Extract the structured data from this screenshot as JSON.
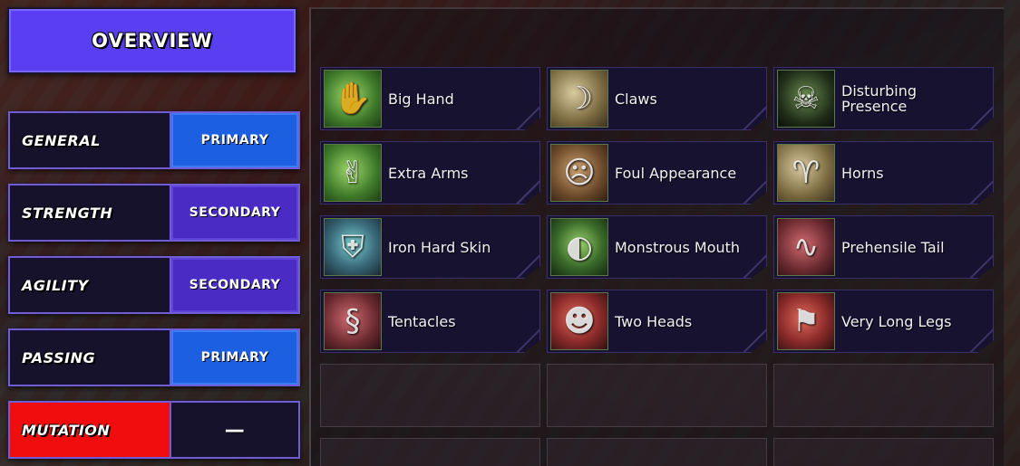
{
  "overview": {
    "label": "OVERVIEW"
  },
  "stats": [
    {
      "label": "GENERAL",
      "value": "PRIMARY",
      "kind": "primary"
    },
    {
      "label": "STRENGTH",
      "value": "SECONDARY",
      "kind": "secondary"
    },
    {
      "label": "AGILITY",
      "value": "SECONDARY",
      "kind": "secondary"
    },
    {
      "label": "PASSING",
      "value": "PRIMARY",
      "kind": "primary"
    },
    {
      "label": "MUTATION",
      "value": "—",
      "kind": "none"
    }
  ],
  "colors": {
    "overview": "#5a3ff2",
    "primary": "#1c5fe0",
    "secondary": "#4a2bc4",
    "mutation": "#f10d0d",
    "card": "#171230"
  },
  "skills": [
    {
      "name": "Big Hand",
      "icon": "hand-icon"
    },
    {
      "name": "Claws",
      "icon": "claw-icon"
    },
    {
      "name": "Disturbing Presence",
      "icon": "ghost-face-icon"
    },
    {
      "name": "Extra Arms",
      "icon": "arms-icon"
    },
    {
      "name": "Foul Appearance",
      "icon": "ugly-face-icon"
    },
    {
      "name": "Horns",
      "icon": "horn-icon"
    },
    {
      "name": "Iron Hard Skin",
      "icon": "armor-icon"
    },
    {
      "name": "Monstrous Mouth",
      "icon": "mouth-icon"
    },
    {
      "name": "Prehensile Tail",
      "icon": "tail-icon"
    },
    {
      "name": "Tentacles",
      "icon": "tentacle-icon"
    },
    {
      "name": "Two Heads",
      "icon": "two-heads-icon"
    },
    {
      "name": "Very Long Legs",
      "icon": "legs-icon"
    }
  ]
}
